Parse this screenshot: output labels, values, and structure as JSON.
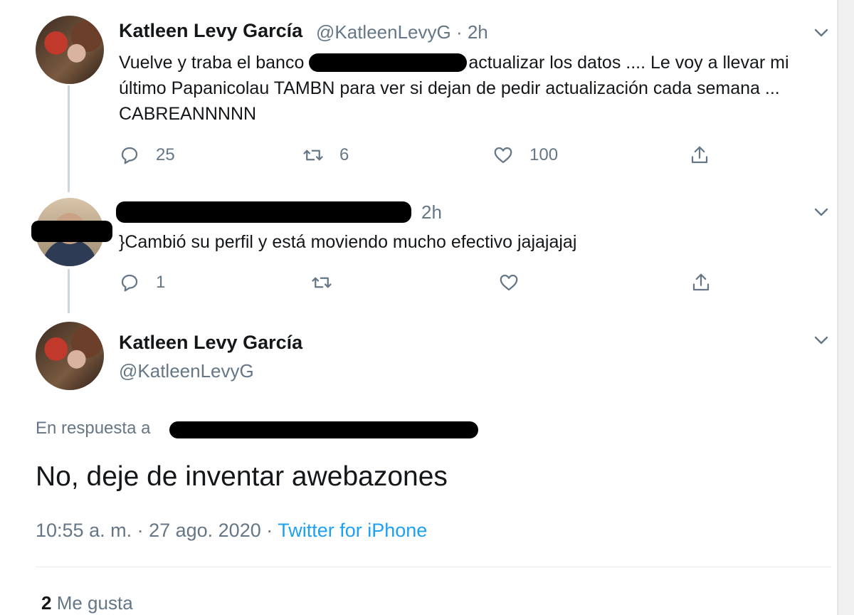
{
  "tweet1": {
    "name": "Katleen Levy García",
    "handle": "@KatleenLevyG · 2h",
    "text_part1": "Vuelve y traba el banco ",
    "text_part2": "actualizar los datos .... Le voy a llevar mi último Papanicolau TAMBN para ver si dejan de pedir actualización cada semana ... CABREANNNNN",
    "replies": "25",
    "retweets": "6",
    "likes": "100"
  },
  "tweet2": {
    "time": "2h",
    "text": "}Cambió su perfil y está moviendo mucho efectivo jajajajaj",
    "replies": "1",
    "retweets": "",
    "likes": ""
  },
  "main_tweet": {
    "name": "Katleen Levy García",
    "handle": "@KatleenLevyG",
    "reply_to_label": "En respuesta a",
    "text": "No, deje de inventar awebazones",
    "timestamp": "10:55 a. m. · 27 ago. 2020 · ",
    "source": "Twitter for iPhone",
    "likes_count": "2",
    "likes_label": "Me gusta"
  },
  "icons": [
    "chevron-down-icon",
    "reply-icon",
    "retweet-icon",
    "like-icon",
    "share-icon"
  ],
  "colors": {
    "text": "#14171a",
    "secondary": "#657786",
    "link": "#1da1f2",
    "thread_line": "#ccd6dd"
  }
}
